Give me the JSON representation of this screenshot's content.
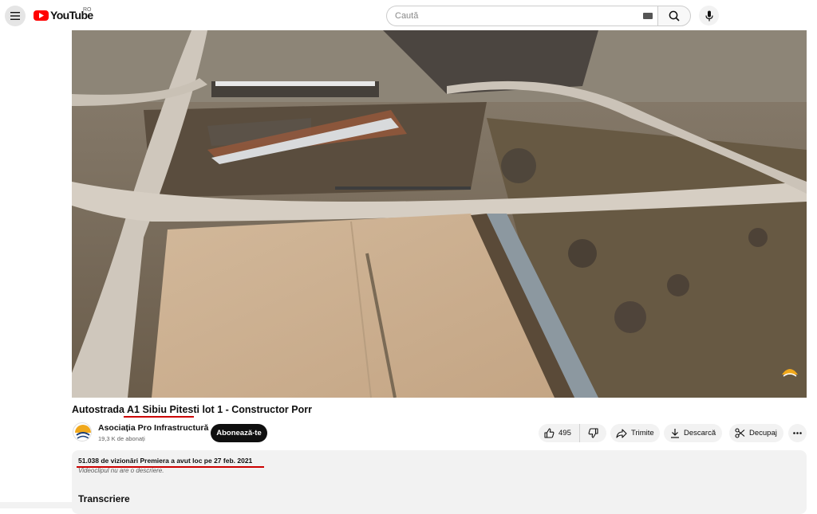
{
  "header": {
    "logo_text": "YouTube",
    "country_code": "RO",
    "search_placeholder": "Caută"
  },
  "video": {
    "title": "Autostrada A1 Sibiu Pitesti lot 1 - Constructor Porr"
  },
  "channel": {
    "name": "Asociația Pro Infrastructură",
    "subscribers": "19,3 K de abonați",
    "subscribe_label": "Abonează-te"
  },
  "actions": {
    "like_count": "495",
    "share_label": "Trimite",
    "download_label": "Descarcă",
    "clip_label": "Decupaj"
  },
  "description": {
    "views_line": "51.038 de vizionări  Premiera a avut loc pe 27 feb. 2021",
    "no_description": "Videoclipul nu are o descriere.",
    "transcript_title": "Transcriere"
  },
  "colors": {
    "brand_red": "#ff0000",
    "annotation_red": "#cc0000",
    "pill_bg": "#f2f2f2"
  }
}
